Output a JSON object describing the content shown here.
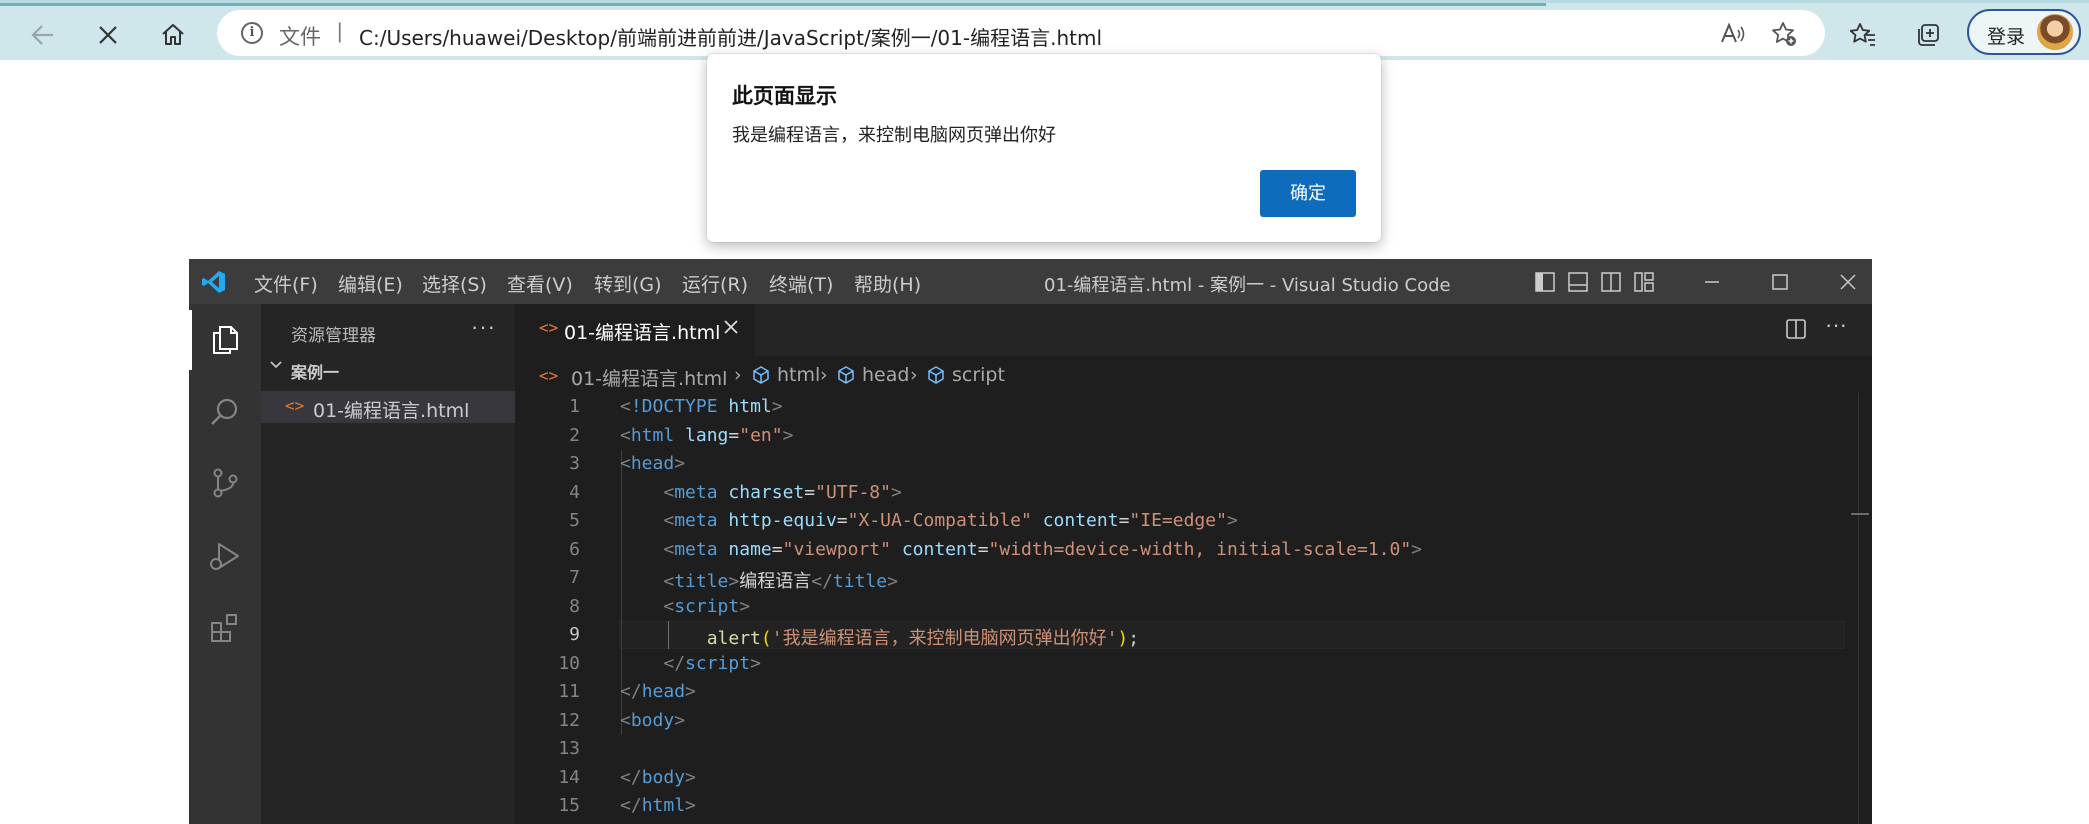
{
  "browser": {
    "url_scheme_label": "文件",
    "url_separator": "|",
    "url": "C:/Users/huawei/Desktop/前端前进前前进/JavaScript/案例一/01-编程语言.html",
    "login_label": "登录",
    "load_progress": 0.74,
    "icons": [
      "back-arrow-icon",
      "stop-x-icon",
      "home-icon",
      "info-icon",
      "read-aloud-icon",
      "add-favorite-icon",
      "favorites-icon",
      "collections-icon",
      "avatar"
    ]
  },
  "dialog": {
    "title": "此页面显示",
    "message": "我是编程语言，来控制电脑网页弹出你好",
    "ok_label": "确定",
    "ok_color": "#0f6cbd"
  },
  "vscode": {
    "menu": [
      "文件(F)",
      "编辑(E)",
      "选择(S)",
      "查看(V)",
      "转到(G)",
      "运行(R)",
      "终端(T)",
      "帮助(H)"
    ],
    "window_title": "01-编程语言.html - 案例一 - Visual Studio Code",
    "sidebar_title": "资源管理器",
    "sidebar_more": "···",
    "folder_name": "案例一",
    "file_name": "01-编程语言.html",
    "file_icon": "<>",
    "tab_label": "01-编程语言.html",
    "editor_more": "···",
    "breadcrumbs": [
      "01-编程语言.html",
      "html",
      "head",
      "script"
    ],
    "accent_color": "#007acc",
    "current_line": 9,
    "code_lines": [
      {
        "n": "1",
        "tokens": [
          [
            "p",
            "<"
          ],
          [
            "t",
            "!DOCTYPE"
          ],
          [
            "d",
            " "
          ],
          [
            "a",
            "html"
          ],
          [
            "p",
            ">"
          ]
        ]
      },
      {
        "n": "2",
        "tokens": [
          [
            "p",
            "<"
          ],
          [
            "t",
            "html"
          ],
          [
            "d",
            " "
          ],
          [
            "a",
            "lang"
          ],
          [
            "d",
            "="
          ],
          [
            "s",
            "\"en\""
          ],
          [
            "p",
            ">"
          ]
        ]
      },
      {
        "n": "3",
        "tokens": [
          [
            "p",
            "<"
          ],
          [
            "t",
            "head"
          ],
          [
            "p",
            ">"
          ]
        ]
      },
      {
        "n": "4",
        "tokens": [
          [
            "d",
            "    "
          ],
          [
            "p",
            "<"
          ],
          [
            "t",
            "meta"
          ],
          [
            "d",
            " "
          ],
          [
            "a",
            "charset"
          ],
          [
            "d",
            "="
          ],
          [
            "s",
            "\"UTF-8\""
          ],
          [
            "p",
            ">"
          ]
        ]
      },
      {
        "n": "5",
        "tokens": [
          [
            "d",
            "    "
          ],
          [
            "p",
            "<"
          ],
          [
            "t",
            "meta"
          ],
          [
            "d",
            " "
          ],
          [
            "a",
            "http-equiv"
          ],
          [
            "d",
            "="
          ],
          [
            "s",
            "\"X-UA-Compatible\""
          ],
          [
            "d",
            " "
          ],
          [
            "a",
            "content"
          ],
          [
            "d",
            "="
          ],
          [
            "s",
            "\"IE=edge\""
          ],
          [
            "p",
            ">"
          ]
        ]
      },
      {
        "n": "6",
        "tokens": [
          [
            "d",
            "    "
          ],
          [
            "p",
            "<"
          ],
          [
            "t",
            "meta"
          ],
          [
            "d",
            " "
          ],
          [
            "a",
            "name"
          ],
          [
            "d",
            "="
          ],
          [
            "s",
            "\"viewport\""
          ],
          [
            "d",
            " "
          ],
          [
            "a",
            "content"
          ],
          [
            "d",
            "="
          ],
          [
            "s",
            "\"width=device-width, initial-scale=1.0\""
          ],
          [
            "p",
            ">"
          ]
        ]
      },
      {
        "n": "7",
        "tokens": [
          [
            "d",
            "    "
          ],
          [
            "p",
            "<"
          ],
          [
            "t",
            "title"
          ],
          [
            "p",
            ">"
          ],
          [
            "d",
            "编程语言"
          ],
          [
            "p",
            "</"
          ],
          [
            "t",
            "title"
          ],
          [
            "p",
            ">"
          ]
        ]
      },
      {
        "n": "8",
        "tokens": [
          [
            "d",
            "    "
          ],
          [
            "p",
            "<"
          ],
          [
            "t",
            "script"
          ],
          [
            "p",
            ">"
          ]
        ]
      },
      {
        "n": "9",
        "tokens": [
          [
            "d",
            "        "
          ],
          [
            "f",
            "alert"
          ],
          [
            "y",
            "("
          ],
          [
            "s",
            "'我是编程语言，来控制电脑网页弹出你好'"
          ],
          [
            "y",
            ")"
          ],
          [
            "d",
            ";"
          ]
        ]
      },
      {
        "n": "10",
        "tokens": [
          [
            "d",
            "    "
          ],
          [
            "p",
            "</"
          ],
          [
            "t",
            "script"
          ],
          [
            "p",
            ">"
          ]
        ]
      },
      {
        "n": "11",
        "tokens": [
          [
            "p",
            "</"
          ],
          [
            "t",
            "head"
          ],
          [
            "p",
            ">"
          ]
        ]
      },
      {
        "n": "12",
        "tokens": [
          [
            "p",
            "<"
          ],
          [
            "t",
            "body"
          ],
          [
            "p",
            ">"
          ]
        ]
      },
      {
        "n": "13",
        "tokens": []
      },
      {
        "n": "14",
        "tokens": [
          [
            "p",
            "</"
          ],
          [
            "t",
            "body"
          ],
          [
            "p",
            ">"
          ]
        ]
      },
      {
        "n": "15",
        "tokens": [
          [
            "p",
            "</"
          ],
          [
            "t",
            "html"
          ],
          [
            "p",
            ">"
          ]
        ]
      }
    ]
  }
}
